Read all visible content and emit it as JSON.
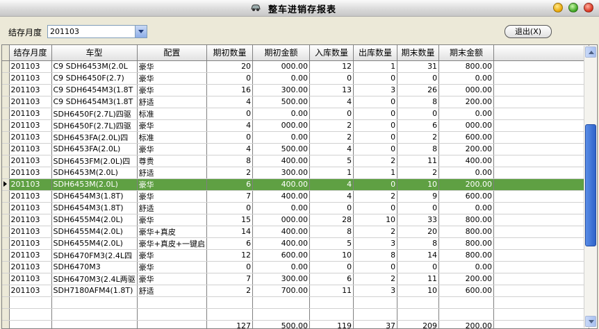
{
  "window": {
    "title": "整车进销存报表",
    "icon": "car-icon"
  },
  "toolbar": {
    "month_label": "结存月度",
    "month_value": "201103",
    "exit_label": "退出(X)"
  },
  "grid": {
    "columns": [
      "结存月度",
      "车型",
      "配置",
      "期初数量",
      "期初金额",
      "入库数量",
      "出库数量",
      "期末数量",
      "期末金额"
    ],
    "rows": [
      [
        "201103",
        "C9  SDH6453M(2.0L",
        "豪华",
        "20",
        "000.00",
        "12",
        "1",
        "31",
        "800.00"
      ],
      [
        "201103",
        "C9 SDH6450F(2.7)",
        "豪华",
        "0",
        "0.00",
        "0",
        "0",
        "0",
        "0.00"
      ],
      [
        "201103",
        "C9 SDH6454M3(1.8T",
        "豪华",
        "16",
        "300.00",
        "13",
        "3",
        "26",
        "000.00"
      ],
      [
        "201103",
        "C9 SDH6454M3(1.8T",
        "舒适",
        "4",
        "500.00",
        "4",
        "0",
        "8",
        "200.00"
      ],
      [
        "201103",
        "SDH6450F(2.7L)四驱",
        "标准",
        "0",
        "0.00",
        "0",
        "0",
        "0",
        "0.00"
      ],
      [
        "201103",
        "SDH6450F(2.7L)四驱",
        "豪华",
        "4",
        "000.00",
        "2",
        "0",
        "6",
        "000.00"
      ],
      [
        "201103",
        "SDH6453FA(2.0L)四",
        "标准",
        "0",
        "0.00",
        "2",
        "0",
        "2",
        "600.00"
      ],
      [
        "201103",
        "SDH6453FA(2.0L)",
        "豪华",
        "4",
        "500.00",
        "4",
        "0",
        "8",
        "200.00"
      ],
      [
        "201103",
        "SDH6453FM(2.0L)四",
        "尊贵",
        "8",
        "400.00",
        "5",
        "2",
        "11",
        "400.00"
      ],
      [
        "201103",
        "SDH6453M(2.0L)",
        "舒适",
        "2",
        "300.00",
        "1",
        "1",
        "2",
        "0.00"
      ],
      [
        "201103",
        "SDH6453M(2.0L)",
        "豪华",
        "6",
        "400.00",
        "4",
        "0",
        "10",
        "200.00"
      ],
      [
        "201103",
        "SDH6454M3(1.8T)",
        "豪华",
        "7",
        "400.00",
        "4",
        "2",
        "9",
        "600.00"
      ],
      [
        "201103",
        "SDH6454M3(1.8T)",
        "舒适",
        "0",
        "0.00",
        "0",
        "0",
        "0",
        "0.00"
      ],
      [
        "201103",
        "SDH6455M4(2.0L)",
        "豪华",
        "15",
        "000.00",
        "28",
        "10",
        "33",
        "800.00"
      ],
      [
        "201103",
        "SDH6455M4(2.0L)",
        "豪华+真皮",
        "14",
        "400.00",
        "8",
        "2",
        "20",
        "800.00"
      ],
      [
        "201103",
        "SDH6455M4(2.0L)",
        "豪华+真皮+一键启",
        "6",
        "400.00",
        "5",
        "3",
        "8",
        "800.00"
      ],
      [
        "201103",
        "SDH6470FM3(2.4L四",
        "豪华",
        "12",
        "600.00",
        "10",
        "8",
        "14",
        "800.00"
      ],
      [
        "201103",
        "SDH6470M3",
        "豪华",
        "0",
        "0.00",
        "0",
        "0",
        "0",
        "0.00"
      ],
      [
        "201103",
        "SDH6470M3(2.4L两驱",
        "豪华",
        "7",
        "300.00",
        "6",
        "2",
        "11",
        "200.00"
      ],
      [
        "201103",
        "SDH7180AFM4(1.8T)",
        "舒适",
        "2",
        "700.00",
        "11",
        "3",
        "10",
        "600.00"
      ]
    ],
    "selected_row": 10,
    "totals": [
      "",
      "",
      "",
      "127",
      "500.00",
      "119",
      "37",
      "209",
      "200.00"
    ]
  },
  "scrollbar": {
    "position_fraction": 0.27
  }
}
